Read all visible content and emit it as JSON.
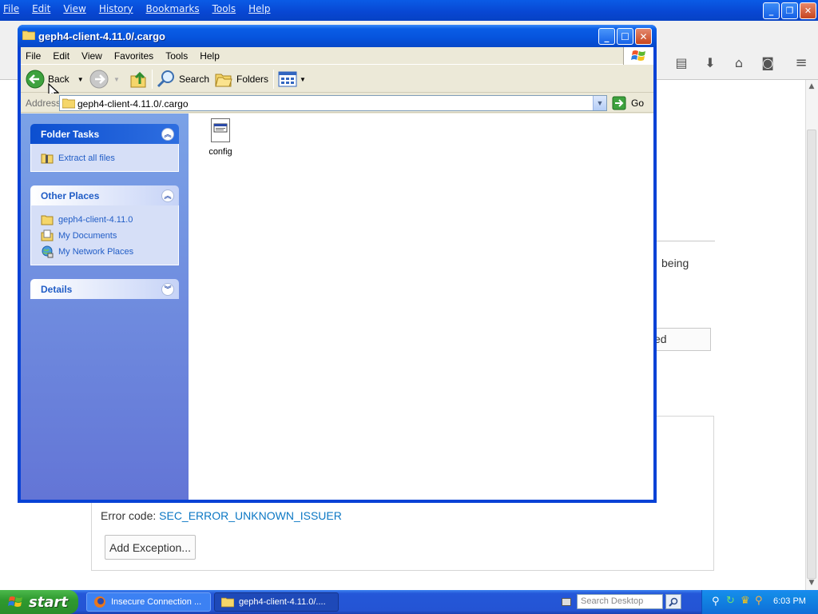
{
  "firefox": {
    "menu": [
      "File",
      "Edit",
      "View",
      "History",
      "Bookmarks",
      "Tools",
      "Help"
    ],
    "error_page": {
      "text_fragment": "being",
      "advanced_fragment": "ced",
      "error_code_label": "Error code:",
      "error_code": "SEC_ERROR_UNKNOWN_ISSUER",
      "add_exception": "Add Exception..."
    }
  },
  "explorer": {
    "title": "geph4-client-4.11.0/.cargo",
    "menu": [
      "File",
      "Edit",
      "View",
      "Favorites",
      "Tools",
      "Help"
    ],
    "toolbar": {
      "back": "Back",
      "search": "Search",
      "folders": "Folders"
    },
    "address": {
      "label": "Address",
      "value": "geph4-client-4.11.0/.cargo",
      "go": "Go"
    },
    "folder_tasks": {
      "title": "Folder Tasks",
      "items": [
        "Extract all files"
      ]
    },
    "other_places": {
      "title": "Other Places",
      "items": [
        "geph4-client-4.11.0",
        "My Documents",
        "My Network Places"
      ]
    },
    "details": {
      "title": "Details"
    },
    "files": [
      {
        "name": "config"
      }
    ]
  },
  "taskbar": {
    "start": "start",
    "tasks": [
      "Insecure Connection ...",
      "geph4-client-4.11.0/...."
    ],
    "search_placeholder": "Search Desktop",
    "clock": "6:03 PM"
  }
}
